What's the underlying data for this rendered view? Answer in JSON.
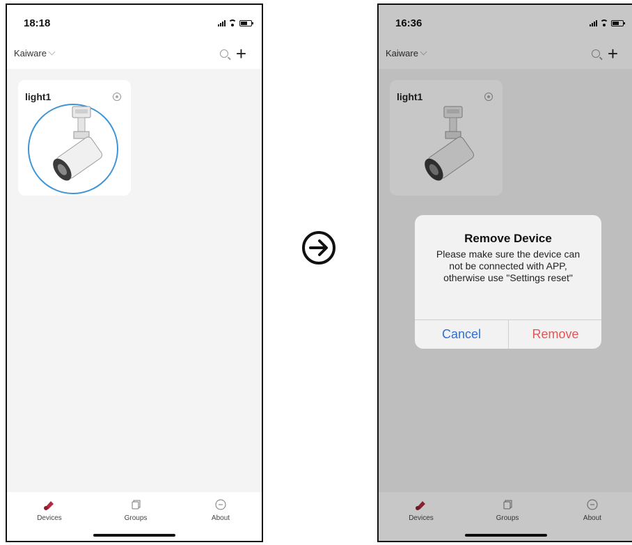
{
  "left_screen": {
    "status_time": "18:18",
    "brand": "Kaiware",
    "device_card": {
      "name": "light1"
    },
    "tabs": [
      {
        "label": "Devices",
        "icon": "devices-icon",
        "active": true
      },
      {
        "label": "Groups",
        "icon": "groups-icon",
        "active": false
      },
      {
        "label": "About",
        "icon": "about-icon",
        "active": false
      }
    ]
  },
  "right_screen": {
    "status_time": "16:36",
    "brand": "Kaiware",
    "device_card": {
      "name": "light1"
    },
    "dialog": {
      "title": "Remove Device",
      "message": "Please make sure the device can not be connected with APP, otherwise use \"Settings reset\"",
      "cancel_label": "Cancel",
      "remove_label": "Remove"
    },
    "tabs": [
      {
        "label": "Devices",
        "icon": "devices-icon",
        "active": true
      },
      {
        "label": "Groups",
        "icon": "groups-icon",
        "active": false
      },
      {
        "label": "About",
        "icon": "about-icon",
        "active": false
      }
    ]
  },
  "colors": {
    "accent_blue": "#3b95d8",
    "cancel_blue": "#2f6fd6",
    "remove_red": "#e05757",
    "devices_tab_red": "#b5283c"
  }
}
